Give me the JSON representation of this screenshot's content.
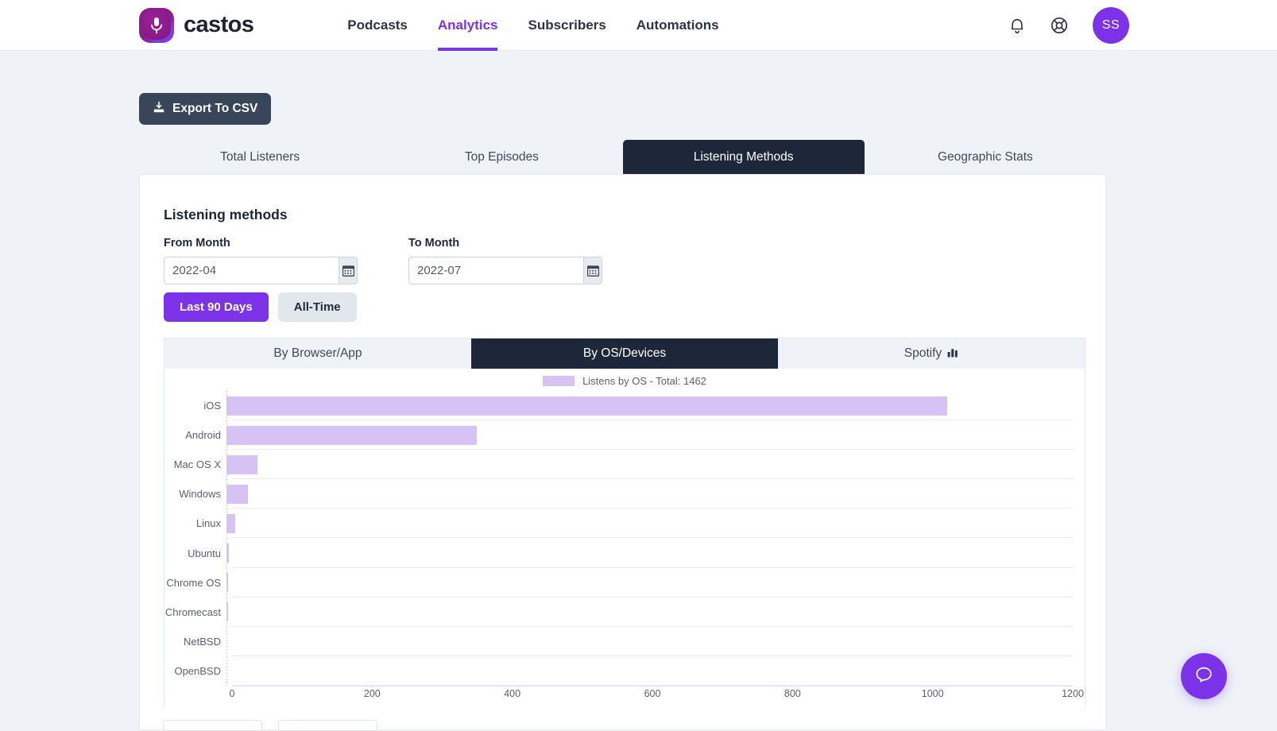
{
  "brand": {
    "name": "castos",
    "logo_icon": "microphone-icon"
  },
  "nav": {
    "items": [
      {
        "label": "Podcasts",
        "active": false
      },
      {
        "label": "Analytics",
        "active": true
      },
      {
        "label": "Subscribers",
        "active": false
      },
      {
        "label": "Automations",
        "active": false
      }
    ],
    "notifications_icon": "bell-icon",
    "help_icon": "lifebuoy-icon",
    "avatar_initials": "SS"
  },
  "toolbar": {
    "export_label": "Export To CSV",
    "export_icon": "export-download-icon"
  },
  "tabs": [
    {
      "label": "Total Listeners",
      "active": false
    },
    {
      "label": "Top Episodes",
      "active": false
    },
    {
      "label": "Listening Methods",
      "active": true
    },
    {
      "label": "Geographic Stats",
      "active": false
    }
  ],
  "panel": {
    "title": "Listening methods",
    "from_month": {
      "label": "From Month",
      "value": "2022-04",
      "placeholder": "YYYY-MM",
      "icon": "calendar-icon"
    },
    "to_month": {
      "label": "To Month",
      "value": "2022-07",
      "placeholder": "YYYY-MM",
      "icon": "calendar-icon"
    },
    "range_buttons": [
      {
        "label": "Last 90 Days",
        "active": true
      },
      {
        "label": "All-Time",
        "active": false
      }
    ],
    "subtabs": [
      {
        "label": "By Browser/App",
        "active": false,
        "icon": ""
      },
      {
        "label": "By OS/Devices",
        "active": true,
        "icon": ""
      },
      {
        "label": "Spotify",
        "active": false,
        "icon": "bar-chart-icon"
      }
    ]
  },
  "fab": {
    "icon": "chat-bubble-icon"
  },
  "colors": {
    "accent_purple": "#7c33e7",
    "dark_navy": "#1e2739",
    "bar_fill": "#d6c2f3",
    "page_bg": "#eff3f7",
    "export_btn": "#394559"
  },
  "chart_data": {
    "type": "bar",
    "orientation": "horizontal",
    "title": "",
    "legend": {
      "label": "Listens by OS - Total: 1462",
      "position": "top-center",
      "swatch_color": "#d6c2f3"
    },
    "total": 1462,
    "categories": [
      "iOS",
      "Android",
      "Mac OS X",
      "Windows",
      "Linux",
      "Ubuntu",
      "Chrome OS",
      "Chromecast",
      "NetBSD",
      "OpenBSD"
    ],
    "values": [
      1022,
      355,
      44,
      30,
      12,
      3,
      1,
      1,
      0,
      0
    ],
    "xlabel": "",
    "ylabel": "",
    "xlim": [
      0,
      1200
    ],
    "xticks": [
      0,
      200,
      400,
      600,
      800,
      1000,
      1200
    ],
    "xtick_labels": [
      "0",
      "200",
      "400",
      "600",
      "800",
      "1000",
      "1200"
    ],
    "grid": true,
    "series": [
      {
        "name": "Listens by OS",
        "values": [
          1022,
          355,
          44,
          30,
          12,
          3,
          1,
          1,
          0,
          0
        ]
      }
    ]
  }
}
